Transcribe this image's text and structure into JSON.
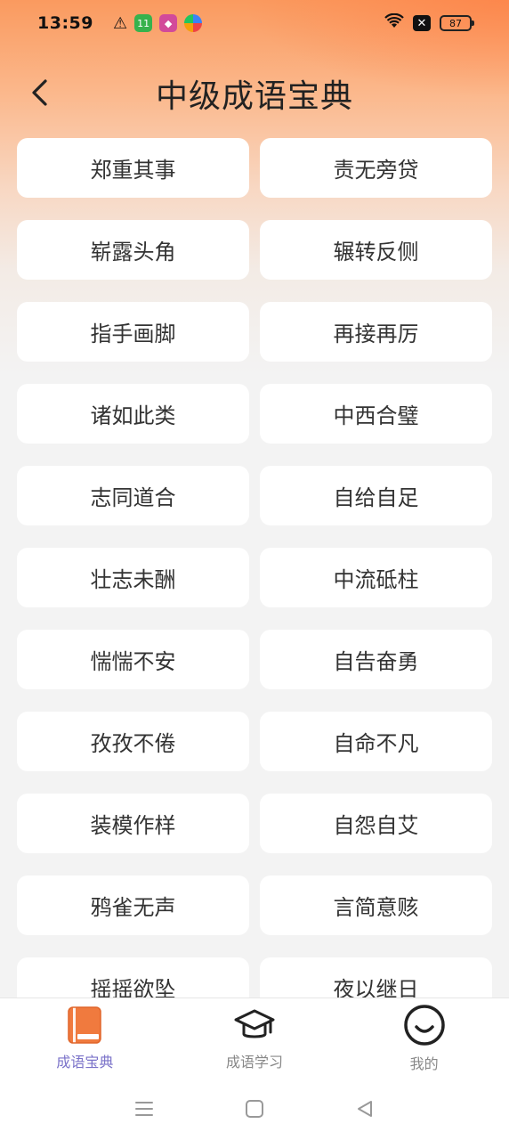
{
  "status": {
    "time": "13:59",
    "notif_badge": "11",
    "battery": "87"
  },
  "header": {
    "title": "中级成语宝典"
  },
  "idioms": [
    "郑重其事",
    "责无旁贷",
    "崭露头角",
    "辗转反侧",
    "指手画脚",
    "再接再厉",
    "诸如此类",
    "中西合璧",
    "志同道合",
    "自给自足",
    "壮志未酬",
    "中流砥柱",
    "惴惴不安",
    "自告奋勇",
    "孜孜不倦",
    "自命不凡",
    "装模作样",
    "自怨自艾",
    "鸦雀无声",
    "言简意赅",
    "摇摇欲坠",
    "夜以继日"
  ],
  "tabs": [
    {
      "label": "成语宝典",
      "icon": "book-icon",
      "active": true
    },
    {
      "label": "成语学习",
      "icon": "graduation-cap-icon",
      "active": false
    },
    {
      "label": "我的",
      "icon": "smiley-icon",
      "active": false
    }
  ],
  "colors": {
    "accent_orange": "#f07a3e",
    "active_tab_text": "#7b73c9"
  }
}
